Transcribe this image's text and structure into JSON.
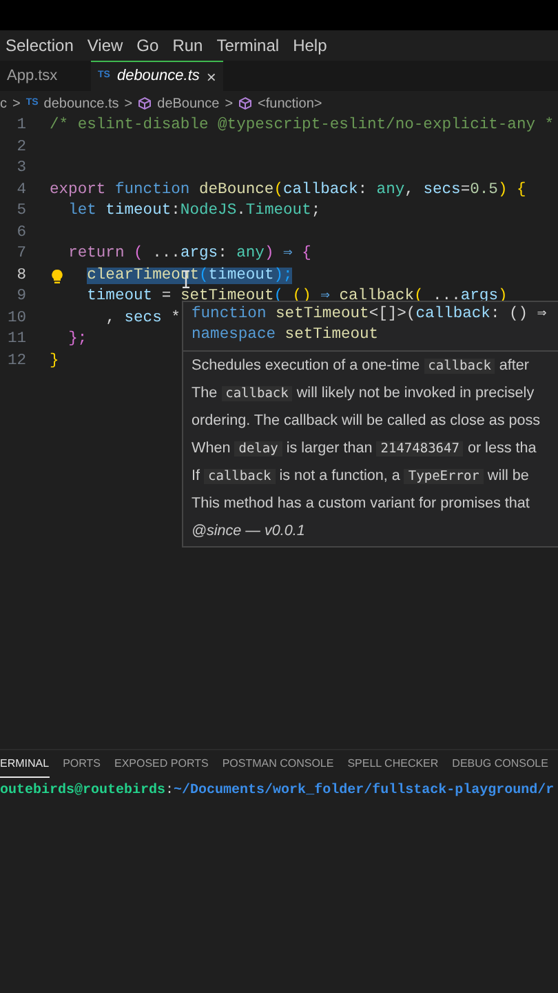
{
  "menu": [
    {
      "label": "Selection"
    },
    {
      "label": "View"
    },
    {
      "label": "Go"
    },
    {
      "label": "Run"
    },
    {
      "label": "Terminal"
    },
    {
      "label": "Help"
    }
  ],
  "tabs": [
    {
      "label": "App.tsx",
      "selected": false
    },
    {
      "label": "debounce.ts",
      "selected": true,
      "icon": "TS",
      "close": "×"
    }
  ],
  "breadcrumb": [
    {
      "label": "c",
      "kind": "folder"
    },
    {
      "label": "debounce.ts",
      "kind": "file",
      "icon": "TS"
    },
    {
      "label": "deBounce",
      "kind": "symbol"
    },
    {
      "label": "<function>",
      "kind": "symbol"
    }
  ],
  "breadcrumb_separator": ">",
  "lines": [
    {
      "number": "1",
      "selected": false,
      "lightbulb": false,
      "tokens": [
        {
          "t": "/* eslint-disable @typescript-eslint/no-explicit-any *",
          "kind": "comment"
        }
      ]
    },
    {
      "number": "2",
      "selected": false,
      "lightbulb": false
    },
    {
      "number": "3",
      "selected": false,
      "lightbulb": false
    },
    {
      "number": "4",
      "selected": false,
      "lightbulb": false,
      "tokens": [
        {
          "t": "export",
          "kind": "control"
        },
        {
          "t": " function",
          "kind": "keyword"
        },
        {
          "t": " deBounce",
          "kind": "func"
        },
        {
          "t": "(",
          "kind": "brace"
        },
        {
          "t": "callback",
          "kind": "var"
        },
        {
          "t": ": ",
          "kind": "plain"
        },
        {
          "t": "any",
          "kind": "type"
        },
        {
          "t": ", ",
          "kind": "plain"
        },
        {
          "t": "secs",
          "kind": "var"
        },
        {
          "t": "=",
          "kind": "plain"
        },
        {
          "t": "0.5",
          "kind": "number"
        },
        {
          "t": ") {",
          "kind": "brace"
        }
      ]
    },
    {
      "number": "5",
      "selected": false,
      "lightbulb": false,
      "tokens": [
        {
          "t": "  let",
          "kind": "keyword"
        },
        {
          "t": " timeout",
          "kind": "var"
        },
        {
          "t": ":",
          "kind": "plain"
        },
        {
          "t": "NodeJS",
          "kind": "type"
        },
        {
          "t": ".",
          "kind": "plain"
        },
        {
          "t": "Timeout",
          "kind": "type"
        },
        {
          "t": ";",
          "kind": "plain"
        }
      ]
    },
    {
      "number": "6",
      "selected": false,
      "lightbulb": false
    },
    {
      "number": "7",
      "selected": false,
      "lightbulb": false,
      "tokens": [
        {
          "t": "  return",
          "kind": "control"
        },
        {
          "t": " (",
          "kind": "brace2"
        },
        {
          "t": " ...",
          "kind": "plain"
        },
        {
          "t": "args",
          "kind": "var"
        },
        {
          "t": ": ",
          "kind": "plain"
        },
        {
          "t": "any",
          "kind": "type"
        },
        {
          "t": ")",
          "kind": "brace2"
        },
        {
          "t": " ⇒ ",
          "kind": "keyword"
        },
        {
          "t": "{",
          "kind": "brace2"
        }
      ]
    },
    {
      "number": "8",
      "selected": true,
      "lightbulb": true,
      "tokens": [
        {
          "t": "    clearTimeout",
          "kind": "func"
        },
        {
          "t": "(",
          "kind": "brace3"
        },
        {
          "t": "timeout",
          "kind": "var"
        },
        {
          "t": ");",
          "kind": "brace3"
        }
      ]
    },
    {
      "number": "9",
      "selected": false,
      "lightbulb": false,
      "tokens": [
        {
          "t": "    timeout",
          "kind": "var"
        },
        {
          "t": " = ",
          "kind": "plain"
        },
        {
          "t": "setTimeout",
          "kind": "func"
        },
        {
          "t": "(",
          "kind": "brace3"
        },
        {
          "t": " ()",
          "kind": "brace"
        },
        {
          "t": " ⇒ ",
          "kind": "keyword"
        },
        {
          "t": "callback",
          "kind": "func"
        },
        {
          "t": "(",
          "kind": "brace"
        },
        {
          "t": " ...",
          "kind": "plain"
        },
        {
          "t": "args",
          "kind": "var"
        },
        {
          "t": ")",
          "kind": "brace"
        }
      ]
    },
    {
      "number": "10",
      "selected": false,
      "lightbulb": false,
      "tokens": [
        {
          "t": "      , ",
          "kind": "plain"
        },
        {
          "t": "secs",
          "kind": "var"
        },
        {
          "t": " *",
          "kind": "plain"
        }
      ]
    },
    {
      "number": "11",
      "selected": false,
      "lightbulb": false,
      "tokens": [
        {
          "t": "  };",
          "kind": "brace2"
        }
      ]
    },
    {
      "number": "12",
      "selected": false,
      "lightbulb": false,
      "tokens": [
        {
          "t": "}",
          "kind": "brace"
        }
      ]
    }
  ],
  "hover": {
    "signature": [
      [
        {
          "t": "function",
          "kind": "keyword"
        },
        {
          "t": " setTimeout",
          "kind": "func"
        },
        {
          "t": "<[]>(",
          "kind": "plain"
        },
        {
          "t": "callback",
          "kind": "var"
        },
        {
          "t": ": () ⇒",
          "kind": "plain"
        }
      ],
      [
        {
          "t": "namespace",
          "kind": "keyword"
        },
        {
          "t": " setTimeout",
          "kind": "func"
        }
      ]
    ],
    "paragraphs": [
      [
        {
          "t": "Schedules execution of a one-time "
        },
        {
          "t": "callback",
          "code": true
        },
        {
          "t": " after"
        }
      ],
      [
        {
          "t": "The "
        },
        {
          "t": "callback",
          "code": true
        },
        {
          "t": " will likely not be invoked in precisely"
        }
      ],
      [
        {
          "t": "ordering. The callback will be called as close as poss"
        }
      ],
      [
        {
          "t": "When "
        },
        {
          "t": "delay",
          "code": true
        },
        {
          "t": " is larger than "
        },
        {
          "t": "2147483647",
          "code": true
        },
        {
          "t": " or less tha"
        }
      ],
      [
        {
          "t": "If "
        },
        {
          "t": "callback",
          "code": true
        },
        {
          "t": " is not a function, a "
        },
        {
          "t": "TypeError",
          "code": true
        },
        {
          "t": " will be"
        }
      ],
      [
        {
          "t": "This method has a custom variant for promises that"
        }
      ]
    ],
    "since": "@since — v0.0.1"
  },
  "panel_tabs": [
    {
      "label": "ERMINAL",
      "selected": true
    },
    {
      "label": "PORTS",
      "selected": false
    },
    {
      "label": "EXPOSED PORTS",
      "selected": false
    },
    {
      "label": "POSTMAN CONSOLE",
      "selected": false
    },
    {
      "label": "SPELL CHECKER",
      "selected": false
    },
    {
      "label": "DEBUG CONSOLE",
      "selected": false
    }
  ],
  "terminal": {
    "user": "outebirds@routebirds",
    "sep": ":",
    "path": "~/Documents/work_folder/fullstack-playground/r"
  }
}
